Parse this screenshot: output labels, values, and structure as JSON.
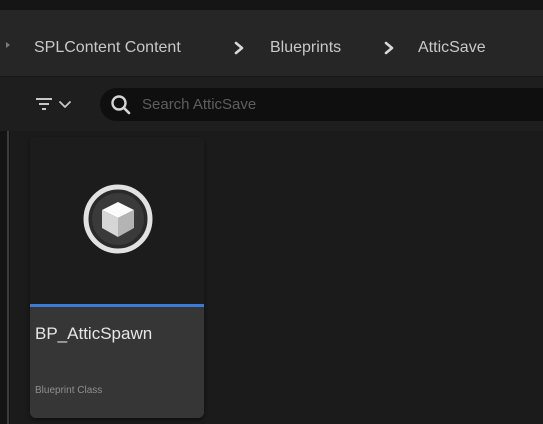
{
  "breadcrumb": {
    "items": [
      {
        "label": "SPLContent Content"
      },
      {
        "label": "Blueprints"
      },
      {
        "label": "AtticSave"
      }
    ]
  },
  "toolbar": {
    "filter_icon": "filter-icon",
    "dropdown_icon": "chevron-down-icon"
  },
  "search": {
    "icon": "search-icon",
    "placeholder": "Search AtticSave",
    "value": ""
  },
  "assets": [
    {
      "name": "BP_AtticSpawn",
      "type": "Blueprint Class",
      "icon": "blueprint-class-icon"
    }
  ],
  "colors": {
    "blueprint_accent": "#3b7bd8"
  }
}
